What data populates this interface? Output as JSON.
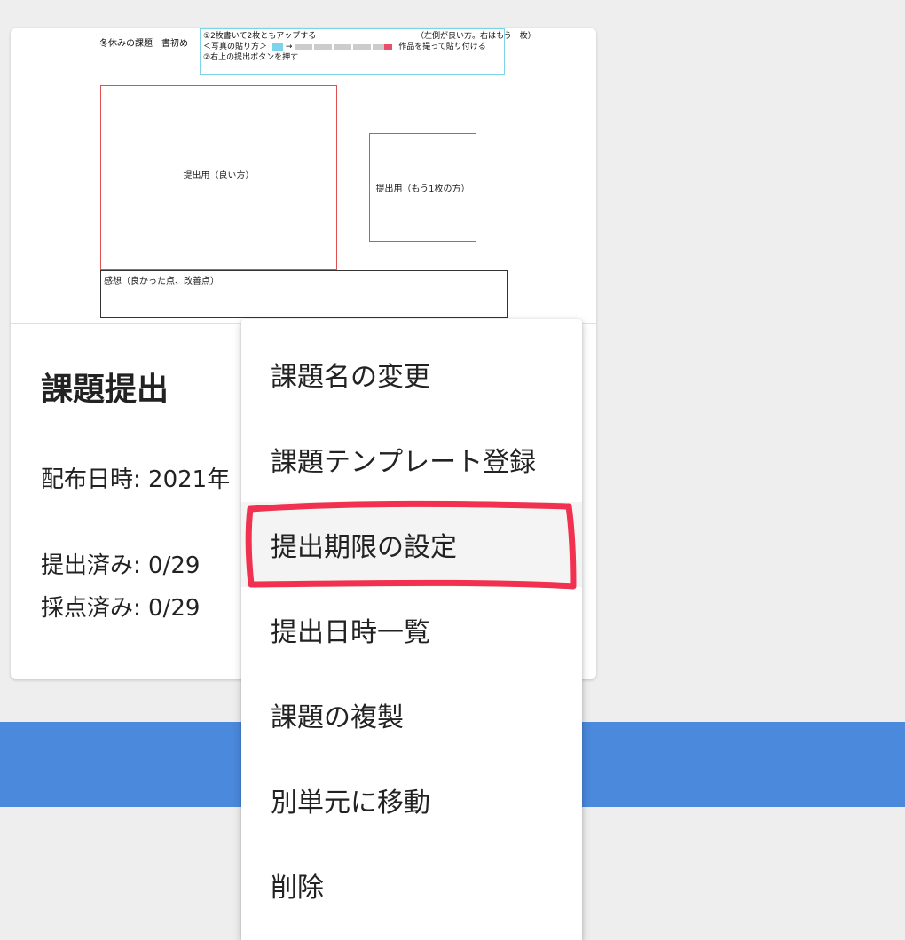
{
  "preview": {
    "heading": "冬休みの課題　書初め",
    "instructions": {
      "line1": "①2枚書いて2枚ともアップする",
      "line1_note": "（左側が良い方。右はもう一枚）",
      "line2": "＜写真の貼り方＞",
      "line2_note": "作品を撮って貼り付ける",
      "line3": "②右上の提出ボタンを押す"
    },
    "left_photo_label": "提出用（良い方）",
    "right_photo_label": "提出用（もう1枚の方）",
    "impressions_label": "感想（良かった点、改善点）"
  },
  "card": {
    "title": "課題提出",
    "distributed": "配布日時: 2021年",
    "submitted": "提出済み: 0/29",
    "graded": "採点済み: 0/29"
  },
  "menu": {
    "items": [
      {
        "label": "課題名の変更"
      },
      {
        "label": "課題テンプレート登録"
      },
      {
        "label": "提出期限の設定"
      },
      {
        "label": "提出日時一覧"
      },
      {
        "label": "課題の複製"
      },
      {
        "label": "別単元に移動"
      },
      {
        "label": "削除"
      }
    ]
  },
  "colors": {
    "background": "#eeeeee",
    "blue_band": "#4a89dc",
    "annotation_red": "#f0314f",
    "photo_frame_red": "#e05050",
    "instruction_frame": "#7fd3e8"
  }
}
